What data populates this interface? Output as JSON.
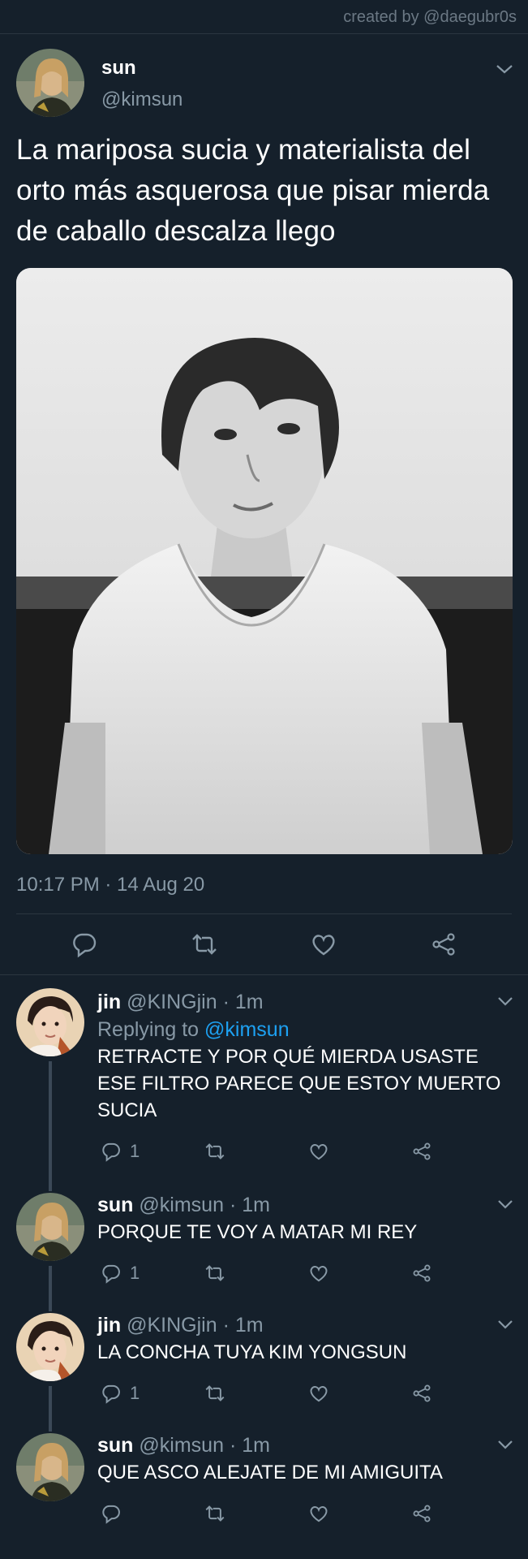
{
  "watermark": "created by @daegubr0s",
  "main_tweet": {
    "name": "sun",
    "handle": "@kimsun",
    "text": "La mariposa sucia y materialista del orto más asquerosa que pisar mierda de caballo descalza llego",
    "timestamp": "10:17 PM · 14 Aug 20",
    "actions": [
      "reply-icon",
      "retweet-icon",
      "like-icon",
      "share-icon"
    ]
  },
  "replies": [
    {
      "name": "jin",
      "handle": "@KINGjin",
      "time": "· 1m",
      "replying_prefix": "Replying to ",
      "replying_to": "@kimsun",
      "text": "RETRACTE Y POR QUÉ MIERDA USASTE ESE FILTRO PARECE QUE ESTOY MUERTO SUCIA",
      "reply_count": "1"
    },
    {
      "name": "sun",
      "handle": "@kimsun",
      "time": "· 1m",
      "text": "PORQUE TE VOY A MATAR MI REY",
      "reply_count": "1"
    },
    {
      "name": "jin",
      "handle": "@KINGjin",
      "time": "· 1m",
      "text": "LA CONCHA TUYA KIM YONGSUN",
      "reply_count": "1"
    },
    {
      "name": "sun",
      "handle": "@kimsun",
      "time": "· 1m",
      "text": "QUE ASCO ALEJATE DE MI AMIGUITA",
      "reply_count": ""
    }
  ],
  "colors": {
    "background": "#15202b",
    "muted_text": "#8899a6",
    "link": "#1da1f2",
    "divider": "#2b3640"
  }
}
